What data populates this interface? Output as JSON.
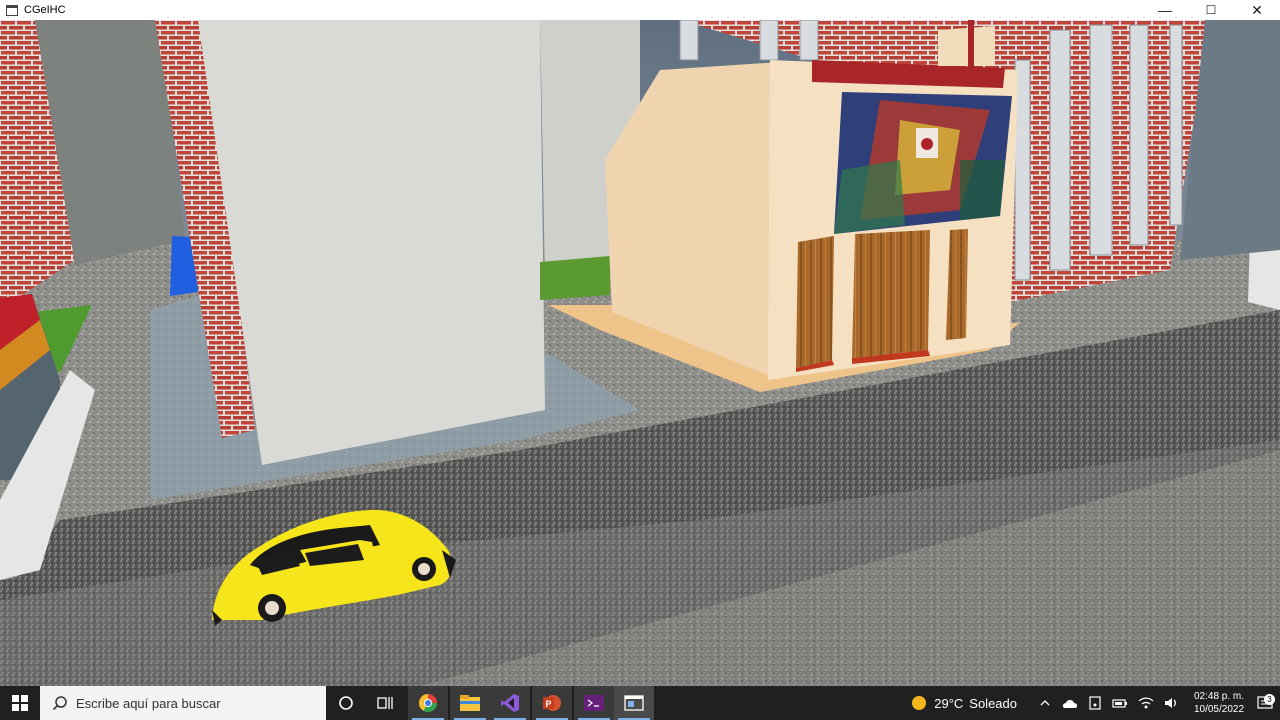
{
  "window": {
    "title": "CGeIHC",
    "controls": {
      "minimize": "—",
      "maximize": "☐",
      "close": "✕"
    }
  },
  "scene": {
    "icons": [
      "brick-building",
      "white-wall-building",
      "church-building",
      "stained-glass-window",
      "wooden-doors",
      "yellow-beetle-car",
      "asphalt-street",
      "sidewalk",
      "grass-patch",
      "blue-object",
      "kiosk-structure"
    ]
  },
  "taskbar": {
    "search_placeholder": "Escribe aquí para buscar",
    "apps": [
      {
        "name": "cortana-icon"
      },
      {
        "name": "task-view-icon"
      },
      {
        "name": "chrome-icon"
      },
      {
        "name": "file-explorer-icon"
      },
      {
        "name": "visual-studio-icon"
      },
      {
        "name": "powerpoint-icon"
      },
      {
        "name": "visual-studio-preview-icon"
      },
      {
        "name": "cgeihc-app-icon"
      }
    ],
    "weather": {
      "temp": "29°C",
      "condition": "Soleado"
    },
    "clock": {
      "time": "02:48 p. m.",
      "date": "10/05/2022"
    },
    "notifications_count": "3"
  }
}
